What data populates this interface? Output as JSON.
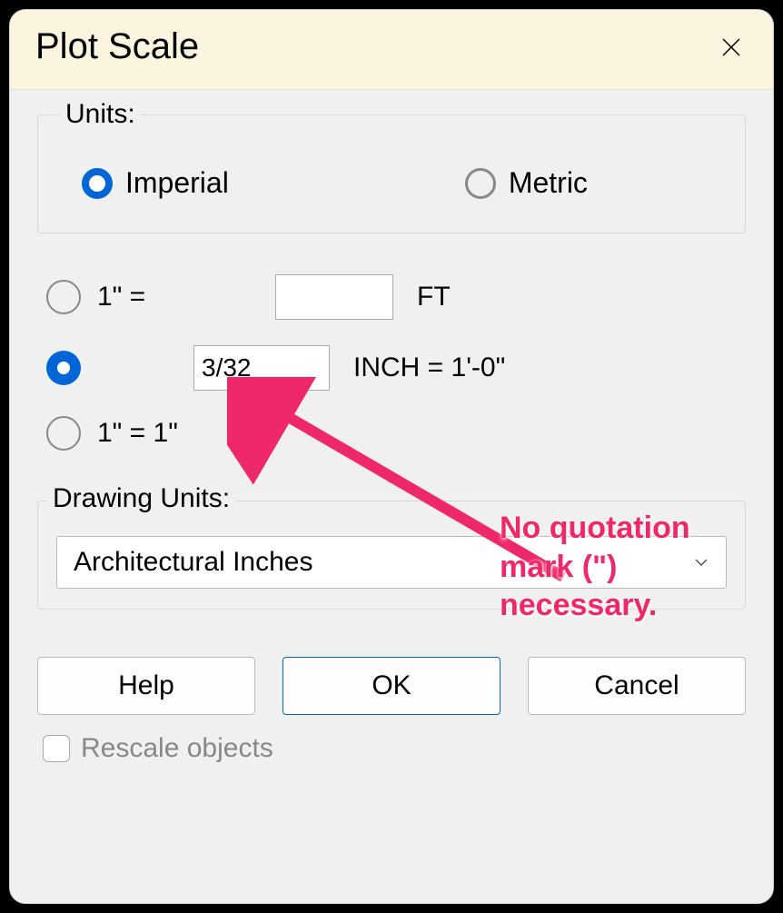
{
  "dialog": {
    "title": "Plot Scale"
  },
  "units": {
    "legend": "Units:",
    "imperial": "Imperial",
    "metric": "Metric",
    "selected": "imperial"
  },
  "scale": {
    "option1": {
      "prefix": "1\" =",
      "value": "",
      "suffix": "FT"
    },
    "option2": {
      "value": "3/32",
      "suffix": "INCH = 1'-0\""
    },
    "option3": {
      "label": "1\" = 1\""
    },
    "selected": 2
  },
  "drawingUnits": {
    "label": "Drawing Units:",
    "value": "Architectural Inches"
  },
  "buttons": {
    "help": "Help",
    "ok": "OK",
    "cancel": "Cancel"
  },
  "rescale": {
    "label": "Rescale objects",
    "checked": false
  },
  "annotation": {
    "text": "No quotation mark (\") necessary."
  }
}
